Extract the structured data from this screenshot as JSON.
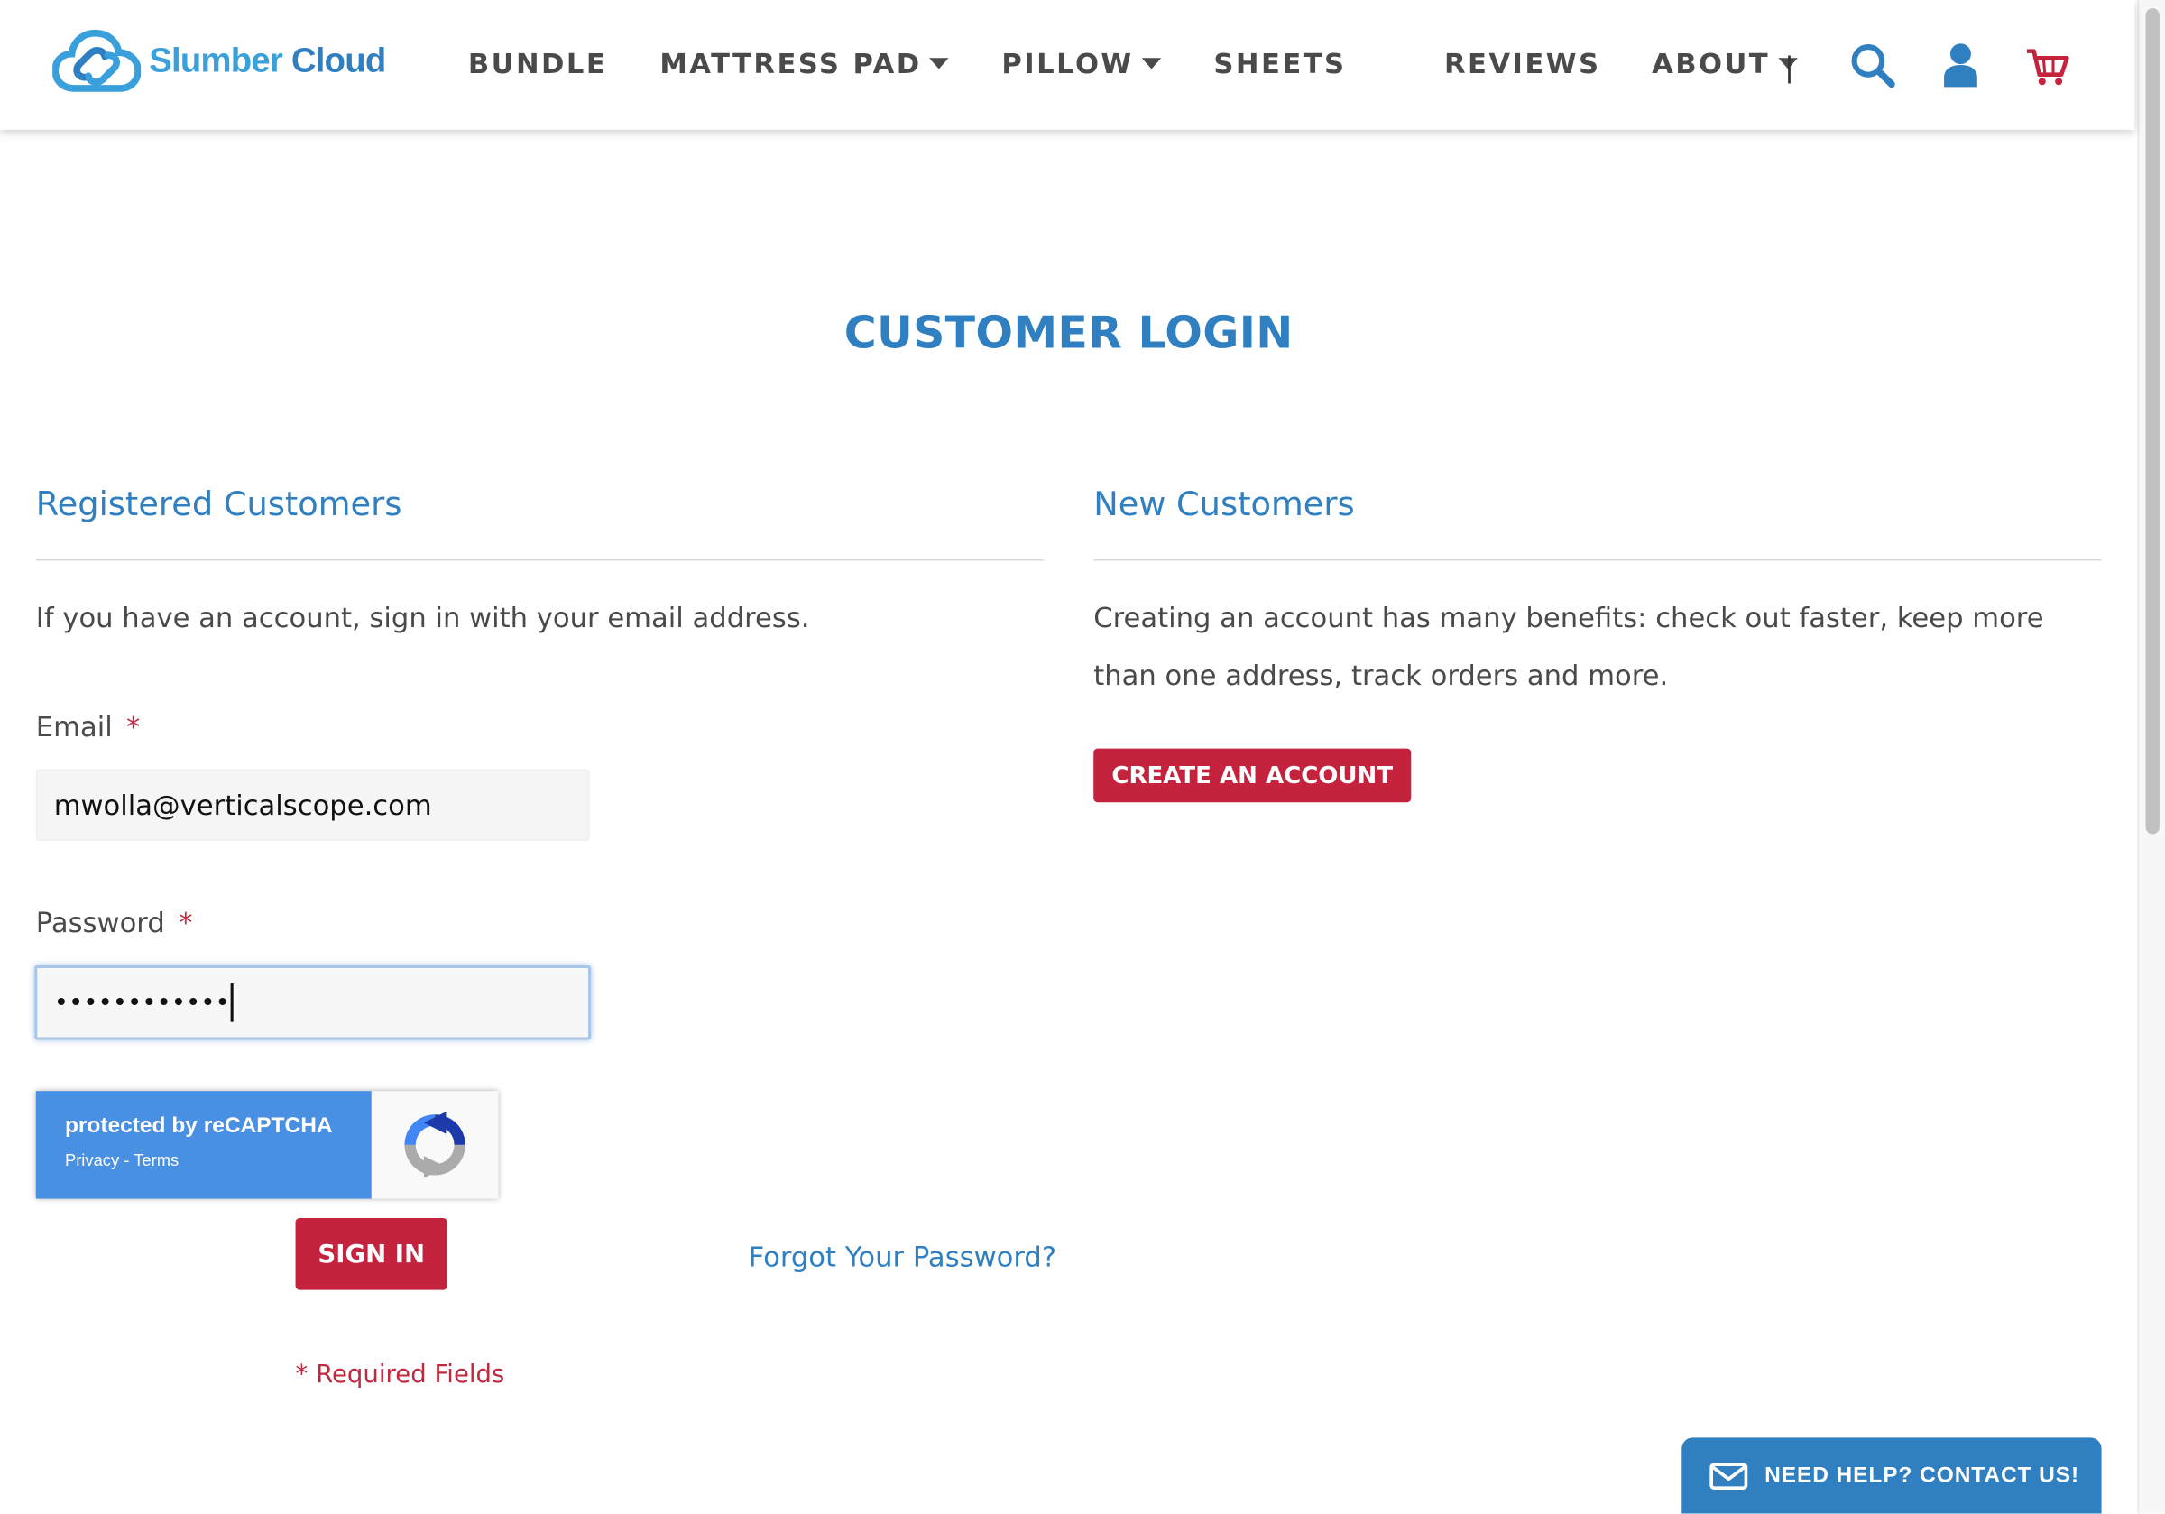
{
  "header": {
    "logo": {
      "word1": "Slumber",
      "word2": "Cloud"
    },
    "nav": [
      {
        "label": "BUNDLE",
        "dropdown": false
      },
      {
        "label": "MATTRESS PAD",
        "dropdown": true
      },
      {
        "label": "PILLOW",
        "dropdown": true
      },
      {
        "label": "SHEETS",
        "dropdown": false
      }
    ],
    "nav_right": [
      {
        "label": "REVIEWS",
        "dropdown": false
      },
      {
        "label": "ABOUT",
        "dropdown": true
      }
    ],
    "separator": "|",
    "icons": [
      "search-icon",
      "account-icon",
      "cart-icon"
    ]
  },
  "page": {
    "title": "CUSTOMER LOGIN"
  },
  "registered": {
    "title": "Registered Customers",
    "intro": "If you have an account, sign in with your email address.",
    "email_label": "Email",
    "email_value": "mwolla@verticalscope.com",
    "password_label": "Password",
    "password_masked": "••••••••••••",
    "required_mark": "*",
    "recaptcha": {
      "protected_text": "protected by reCAPTCHA",
      "privacy": "Privacy",
      "dash": "-",
      "terms": "Terms"
    },
    "signin_button": "SIGN IN",
    "forgot_link": "Forgot Your Password?",
    "required_note": "* Required Fields"
  },
  "new_customers": {
    "title": "New Customers",
    "text": "Creating an account has many benefits: check out faster, keep more than one address, track orders and more.",
    "create_button": "CREATE AN ACCOUNT"
  },
  "help_widget": {
    "label": "NEED HELP? CONTACT US!"
  },
  "colors": {
    "brand_blue": "#2f7fc1",
    "brand_light_blue": "#3aa0dc",
    "accent_red": "#c4223d",
    "recaptcha_blue": "#4a90e2"
  }
}
